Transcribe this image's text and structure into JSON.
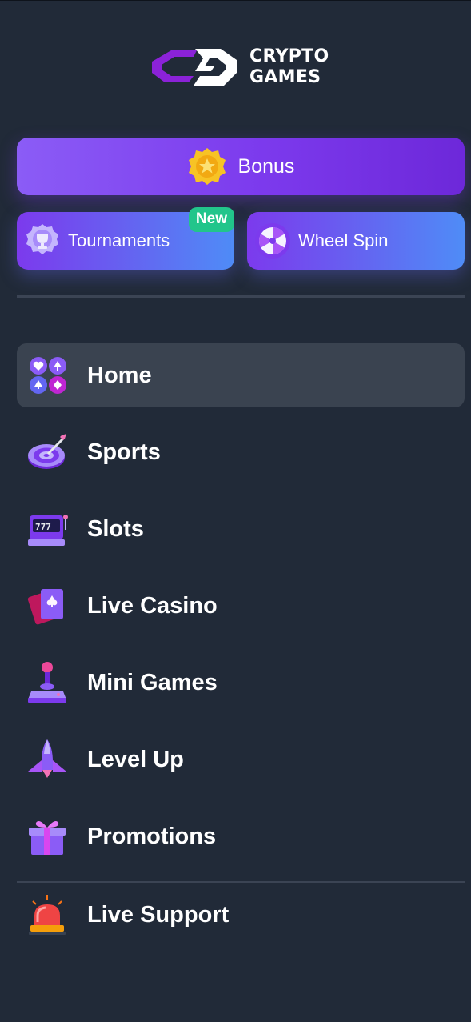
{
  "brand": {
    "line1": "CRYPTO",
    "line2": "GAMES"
  },
  "promos": {
    "bonus_label": "Bonus",
    "tournaments_label": "Tournaments",
    "tournaments_badge": "New",
    "wheel_label": "Wheel Spin"
  },
  "nav": {
    "items": [
      {
        "label": "Home",
        "icon": "card-suits-icon",
        "active": true
      },
      {
        "label": "Sports",
        "icon": "target-dart-icon"
      },
      {
        "label": "Slots",
        "icon": "slot-machine-icon"
      },
      {
        "label": "Live Casino",
        "icon": "playing-cards-icon"
      },
      {
        "label": "Mini Games",
        "icon": "joystick-icon"
      },
      {
        "label": "Level Up",
        "icon": "rocket-icon"
      },
      {
        "label": "Promotions",
        "icon": "gift-icon"
      }
    ],
    "support_label": "Live Support",
    "support_icon": "siren-icon"
  },
  "colors": {
    "background": "#212a38",
    "active_item": "#3a4350",
    "accent_purple": "#7c3aed",
    "accent_blue": "#4f8cf7",
    "badge_green": "#22c58b"
  }
}
